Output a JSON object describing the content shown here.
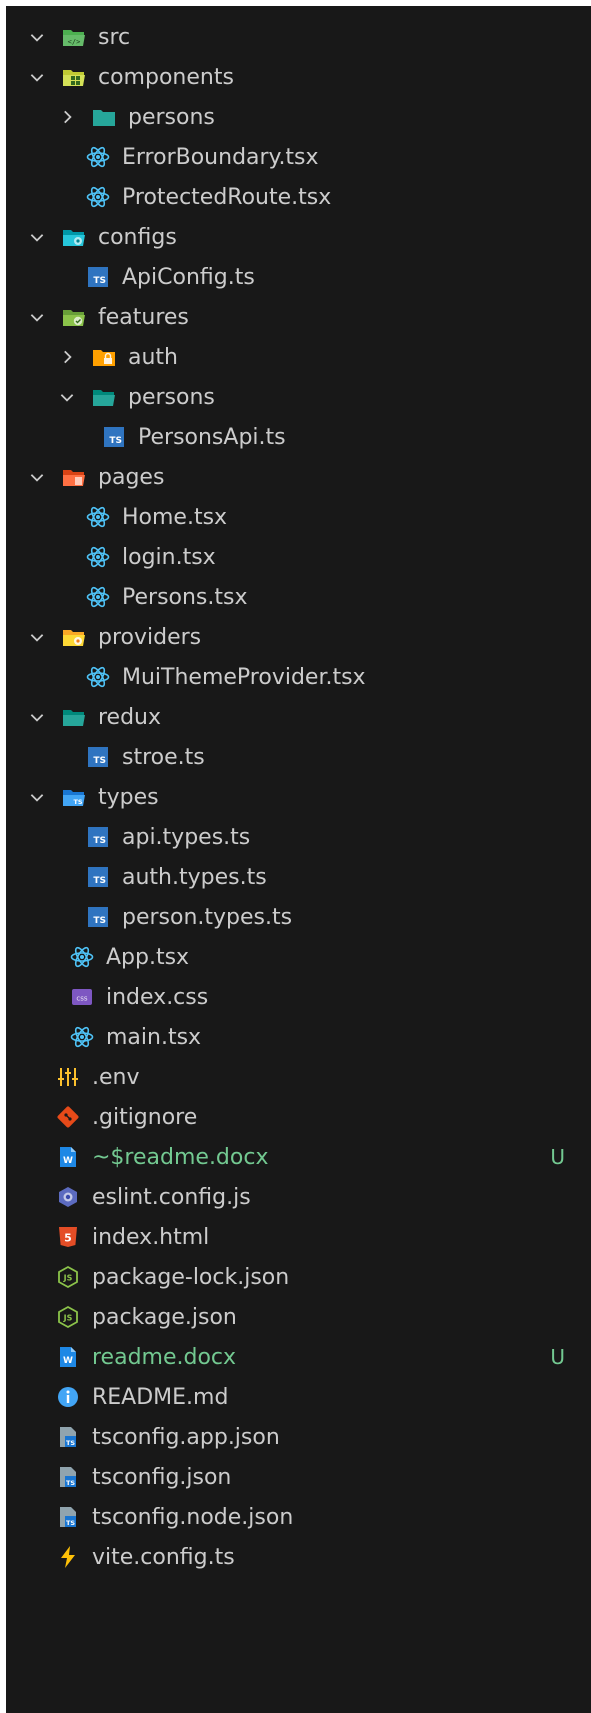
{
  "explorer": {
    "rows": [
      {
        "label": "src",
        "icon": "folder-src-open-icon"
      },
      {
        "label": "components",
        "icon": "folder-components-open-icon"
      },
      {
        "label": "persons",
        "icon": "folder-closed-icon"
      },
      {
        "label": "ErrorBoundary.tsx",
        "icon": "react-icon"
      },
      {
        "label": "ProtectedRoute.tsx",
        "icon": "react-icon"
      },
      {
        "label": "configs",
        "icon": "folder-config-open-icon"
      },
      {
        "label": "ApiConfig.ts",
        "icon": "typescript-icon"
      },
      {
        "label": "features",
        "icon": "folder-features-open-icon"
      },
      {
        "label": "auth",
        "icon": "folder-auth-closed-icon"
      },
      {
        "label": "persons",
        "icon": "folder-open-icon"
      },
      {
        "label": "PersonsApi.ts",
        "icon": "typescript-icon"
      },
      {
        "label": "pages",
        "icon": "folder-pages-open-icon"
      },
      {
        "label": "Home.tsx",
        "icon": "react-icon"
      },
      {
        "label": "login.tsx",
        "icon": "react-icon"
      },
      {
        "label": "Persons.tsx",
        "icon": "react-icon"
      },
      {
        "label": "providers",
        "icon": "folder-providers-open-icon"
      },
      {
        "label": "MuiThemeProvider.tsx",
        "icon": "react-icon"
      },
      {
        "label": "redux",
        "icon": "folder-redux-open-icon"
      },
      {
        "label": "stroe.ts",
        "icon": "typescript-icon"
      },
      {
        "label": "types",
        "icon": "folder-types-open-icon"
      },
      {
        "label": "api.types.ts",
        "icon": "typescript-icon"
      },
      {
        "label": "auth.types.ts",
        "icon": "typescript-icon"
      },
      {
        "label": "person.types.ts",
        "icon": "typescript-icon"
      },
      {
        "label": "App.tsx",
        "icon": "react-icon"
      },
      {
        "label": "index.css",
        "icon": "css-icon"
      },
      {
        "label": "main.tsx",
        "icon": "react-icon"
      },
      {
        "label": ".env",
        "icon": "env-icon"
      },
      {
        "label": ".gitignore",
        "icon": "git-icon"
      },
      {
        "label": "~$readme.docx",
        "icon": "word-icon",
        "badge": "U"
      },
      {
        "label": "eslint.config.js",
        "icon": "eslint-icon"
      },
      {
        "label": "index.html",
        "icon": "html-icon"
      },
      {
        "label": "package-lock.json",
        "icon": "nodejs-icon"
      },
      {
        "label": "package.json",
        "icon": "nodejs-icon"
      },
      {
        "label": "readme.docx",
        "icon": "word-icon",
        "badge": "U"
      },
      {
        "label": "README.md",
        "icon": "info-icon"
      },
      {
        "label": "tsconfig.app.json",
        "icon": "tsconfig-icon"
      },
      {
        "label": "tsconfig.json",
        "icon": "tsconfig-icon"
      },
      {
        "label": "tsconfig.node.json",
        "icon": "tsconfig-icon"
      },
      {
        "label": "vite.config.ts",
        "icon": "vite-icon"
      }
    ]
  },
  "colors": {
    "background": "#181818",
    "text": "#cccccc",
    "untracked": "#73c991"
  }
}
